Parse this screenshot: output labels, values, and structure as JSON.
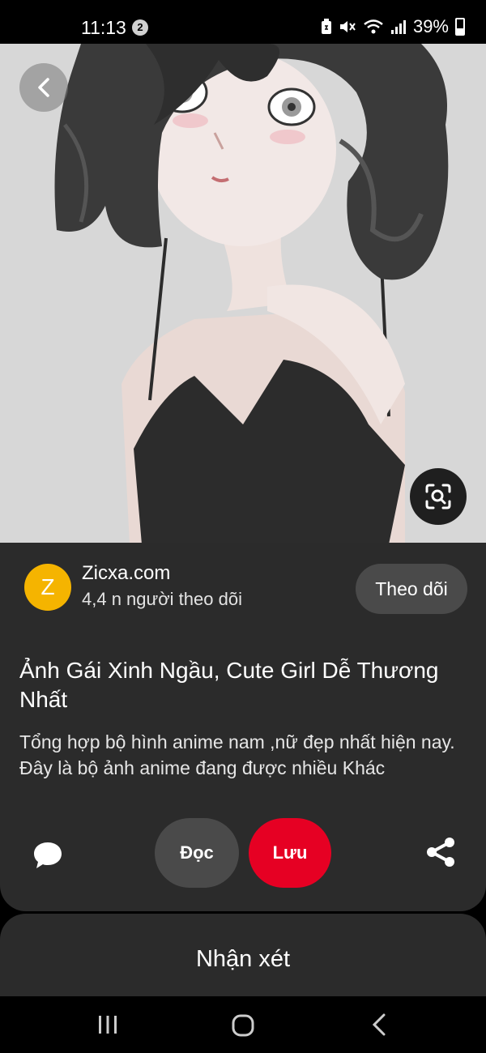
{
  "status_bar": {
    "time": "11:13",
    "notification_count": "2",
    "battery_percent": "39%"
  },
  "pin": {
    "source": {
      "avatar_letter": "Z",
      "avatar_color": "#f5b400",
      "name": "Zicxa.com",
      "followers": "4,4 n người theo dõi"
    },
    "follow_label": "Theo dõi",
    "title": "Ảnh Gái Xinh Ngầu, Cute Girl Dễ Thương Nhất",
    "description": "Tổng hợp bộ hình anime nam ,nữ đẹp nhất hiện nay. Đây là bộ ảnh anime đang được nhiều Khác",
    "read_label": "Đọc",
    "save_label": "Lưu"
  },
  "comments": {
    "title": "Nhận xét"
  },
  "colors": {
    "accent_red": "#e60023",
    "panel_bg": "#2b2b2b",
    "button_gray": "#4a4a4a"
  },
  "icons": {
    "back": "chevron-left-icon",
    "visual_search": "lens-search-icon",
    "comment": "speech-bubble-icon",
    "share": "share-icon"
  }
}
